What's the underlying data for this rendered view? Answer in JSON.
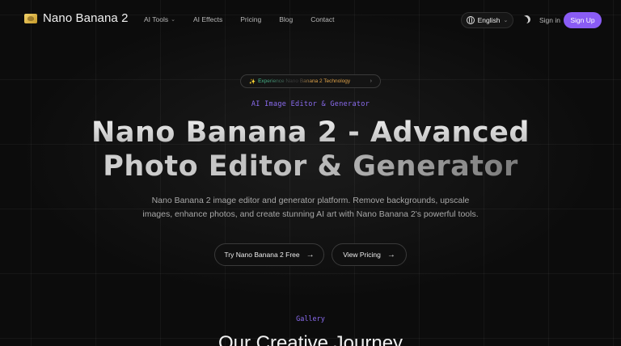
{
  "nav": {
    "brand": "Nano Banana 2",
    "links": [
      "AI Tools",
      "AI Effects",
      "Pricing",
      "Blog",
      "Contact"
    ],
    "language": "English",
    "sign_in": "Sign in",
    "sign_up": "Sign Up"
  },
  "hero": {
    "pill": "Experience Nano Banana 2 Technology",
    "eyebrow": "AI Image Editor & Generator",
    "headline_line1": "Nano Banana 2 - Advanced",
    "headline_line2": "Photo Editor & Generator",
    "sub_line1": "Nano Banana 2 image editor and generator platform. Remove backgrounds, upscale",
    "sub_line2": "images, enhance photos, and create stunning AI art with Nano Banana 2's powerful tools.",
    "cta_primary": "Try Nano Banana 2 Free",
    "cta_secondary": "View Pricing"
  },
  "gallery": {
    "label": "Gallery",
    "title": "Our Creative Journey"
  },
  "colors": {
    "accent": "#8a5cf5",
    "background": "#0c0c0c"
  },
  "icons": [
    "banana-logo-icon",
    "chevron-down-icon",
    "globe-icon",
    "moon-icon",
    "sparkle-icon",
    "chevron-right-icon",
    "arrow-right-icon"
  ]
}
